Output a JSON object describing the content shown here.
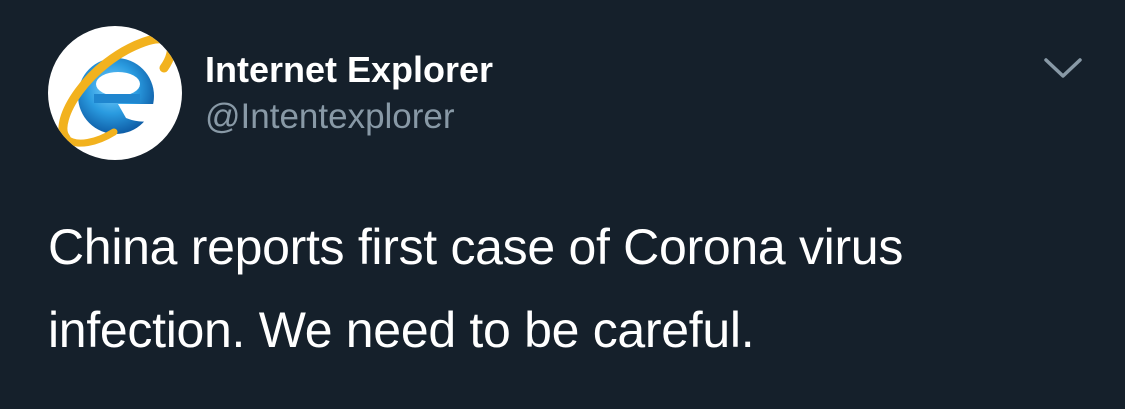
{
  "tweet": {
    "author": {
      "display_name": "Internet Explorer",
      "handle": "@Intentexplorer",
      "avatar_icon": "internet-explorer-logo"
    },
    "more_icon": "chevron-down-icon",
    "text": "China reports first case of Corona virus infection. We need to be careful."
  },
  "colors": {
    "background": "#15202b",
    "primary_text": "#ffffff",
    "secondary_text": "#8899a6",
    "logo_blue": "#1b8fd6",
    "logo_ring": "#f2b21e"
  }
}
